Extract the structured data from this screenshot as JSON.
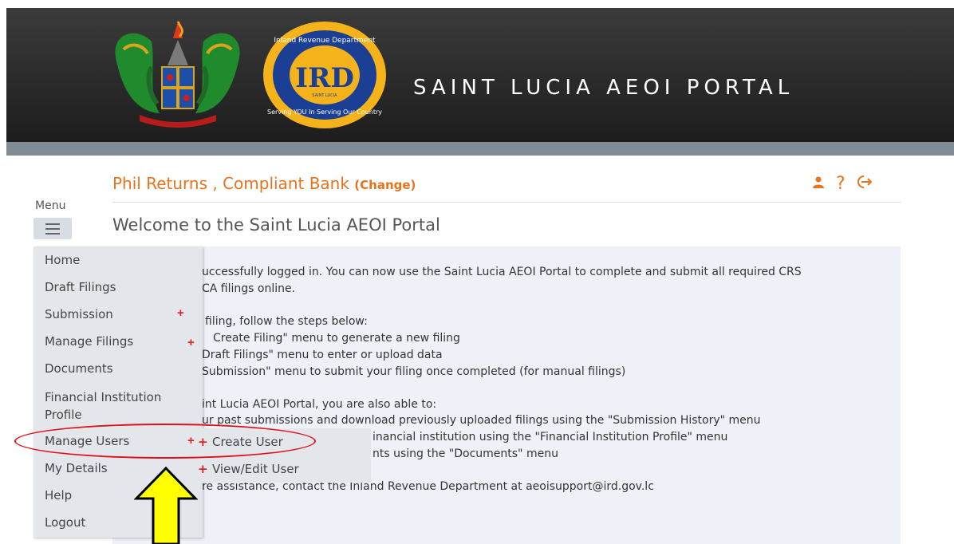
{
  "header": {
    "portal_title": "SAINT LUCIA AEOI PORTAL",
    "logo_ring_text_top": "Inland Revenue Department",
    "logo_ring_text_bottom": "Serving YOU In Serving Our Country",
    "logo_letters": "IRD",
    "logo_small_text": "SAINT LUCIA"
  },
  "user_bar": {
    "user_text": "Phil Returns , Compliant Bank ",
    "change_label": "(Change)",
    "icons": [
      "user-icon",
      "help-icon",
      "logout-icon"
    ],
    "help_glyph": "?"
  },
  "menu": {
    "label": "Menu",
    "items": [
      {
        "label": "Home",
        "has_sub": false
      },
      {
        "label": "Draft Filings",
        "has_sub": false
      },
      {
        "label": "Submission",
        "has_sub": true
      },
      {
        "label": "Manage Filings",
        "has_sub": true
      },
      {
        "label": "Documents",
        "has_sub": false
      },
      {
        "label": "Financial Institution Profile",
        "has_sub": false
      },
      {
        "label": "Manage Users",
        "has_sub": true
      },
      {
        "label": "My Details",
        "has_sub": false
      },
      {
        "label": "Help",
        "has_sub": false
      },
      {
        "label": "Logout",
        "has_sub": false
      }
    ],
    "financial_line1": "Financial Institution",
    "financial_line2": "Profile",
    "submenu": [
      "Create User",
      "View/Edit User"
    ]
  },
  "page": {
    "title": "Welcome to the Saint Lucia AEOI Portal",
    "lines": [
      "uccessfully logged in. You can now use the Saint Lucia AEOI Portal to complete and submit all required CRS",
      "CA filings online.",
      "filing, follow the steps below:",
      "Create Filing\" menu to generate a new filing",
      "Draft Filings\" menu to enter or upload data",
      "Submission\" menu to submit your filing once completed (for manual filings)",
      "int Lucia AEOI Portal, you are also able to:",
      "ur past submissions and download previously uploaded filings using the \"Submission History\" menu",
      "inancial institution using the \"Financial Institution Profile\" menu",
      "nts using the \"Documents\" menu",
      "re assistance, contact the Inland Revenue Department at aeoisupport@ird.gov.lc"
    ]
  },
  "colors": {
    "accent": "#e8731e",
    "annotation_red": "#e0101a",
    "arrow_yellow": "#ffff00"
  }
}
